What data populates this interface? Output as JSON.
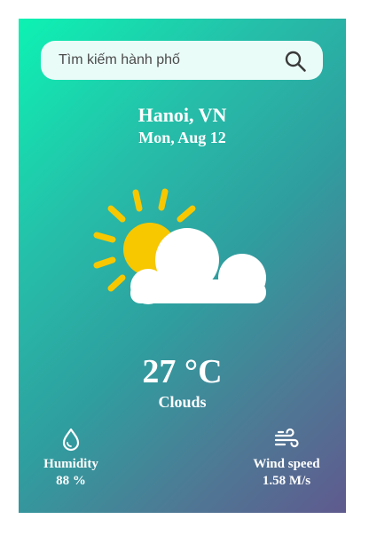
{
  "search": {
    "placeholder": "Tìm kiếm hành phố",
    "icon": "search-icon"
  },
  "location": {
    "city": "Hanoi, VN",
    "date": "Mon, Aug 12"
  },
  "weather": {
    "icon": "partly-cloudy-icon",
    "temperature": "27 °C",
    "condition": "Clouds"
  },
  "stats": {
    "humidity": {
      "icon": "droplet-icon",
      "label": "Humidity",
      "value": "88 %"
    },
    "wind": {
      "icon": "wind-icon",
      "label": "Wind speed",
      "value": "1.58 M/s"
    }
  },
  "colors": {
    "gradient_start": "#0df2b3",
    "gradient_end": "#5f5a8e",
    "sun": "#f7c700",
    "cloud": "#ffffff",
    "search_bg": "#eafcf8"
  }
}
